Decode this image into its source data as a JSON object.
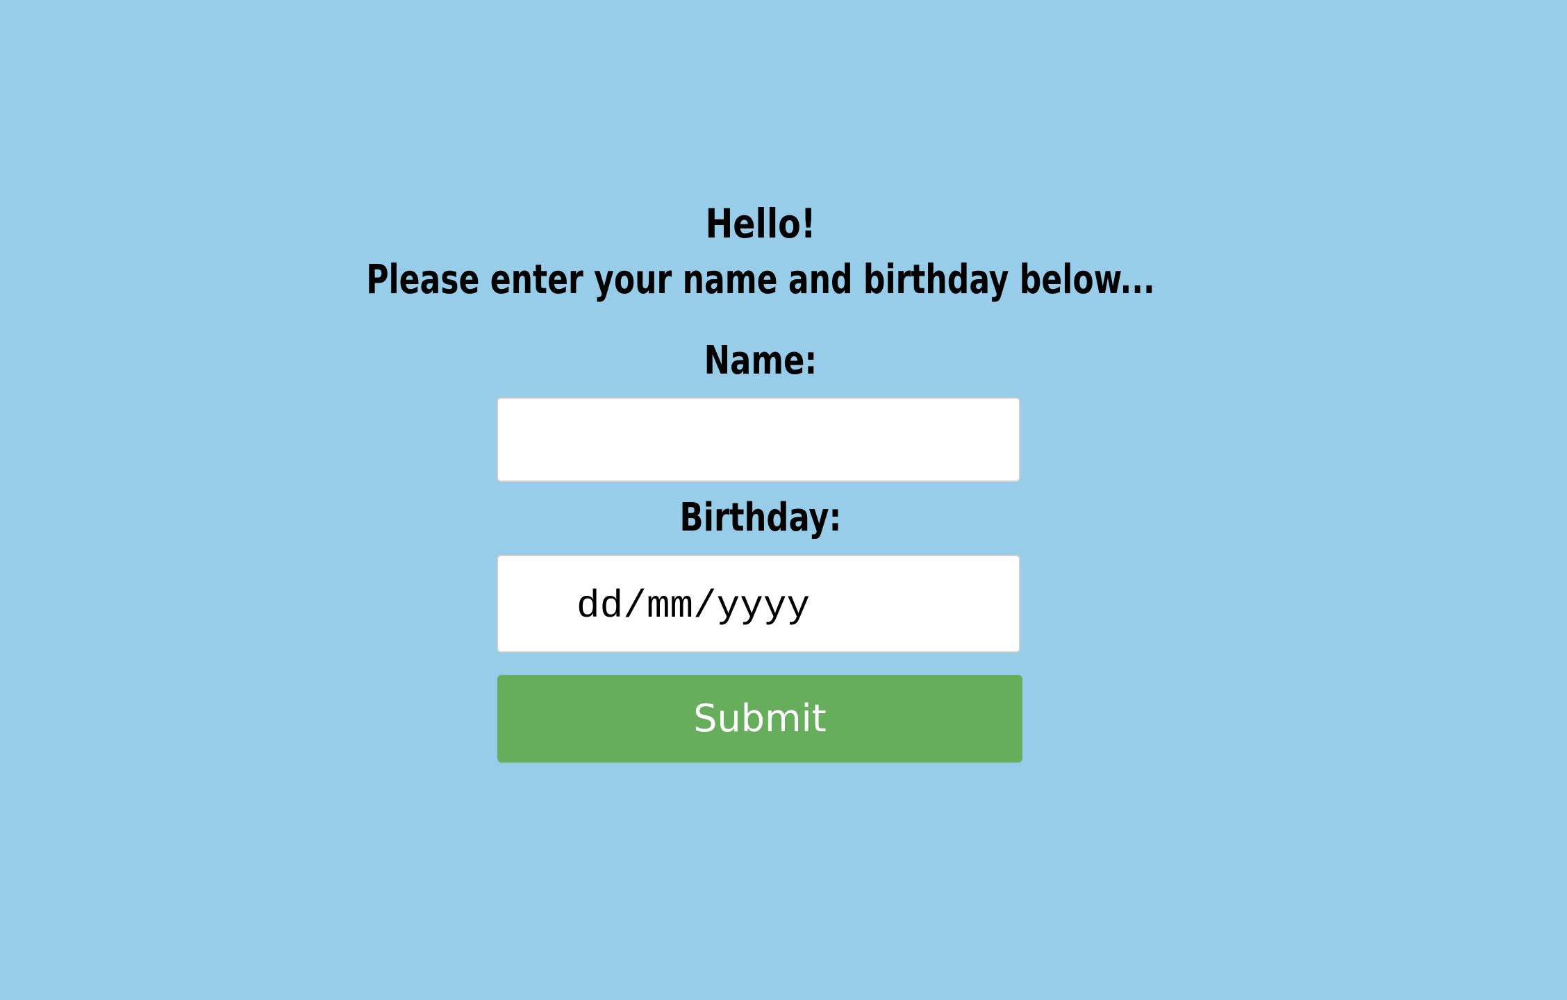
{
  "page": {
    "background_color": "#97cde9"
  },
  "header": {
    "greeting": "Hello!",
    "instruction": "Please enter your name and birthday below..."
  },
  "form": {
    "name_label": "Name:",
    "name_value": "",
    "birthday_label": "Birthday:",
    "birthday_placeholder": "dd/mm/yyyy",
    "submit_label": "Submit",
    "submit_color": "#66ad5c"
  }
}
